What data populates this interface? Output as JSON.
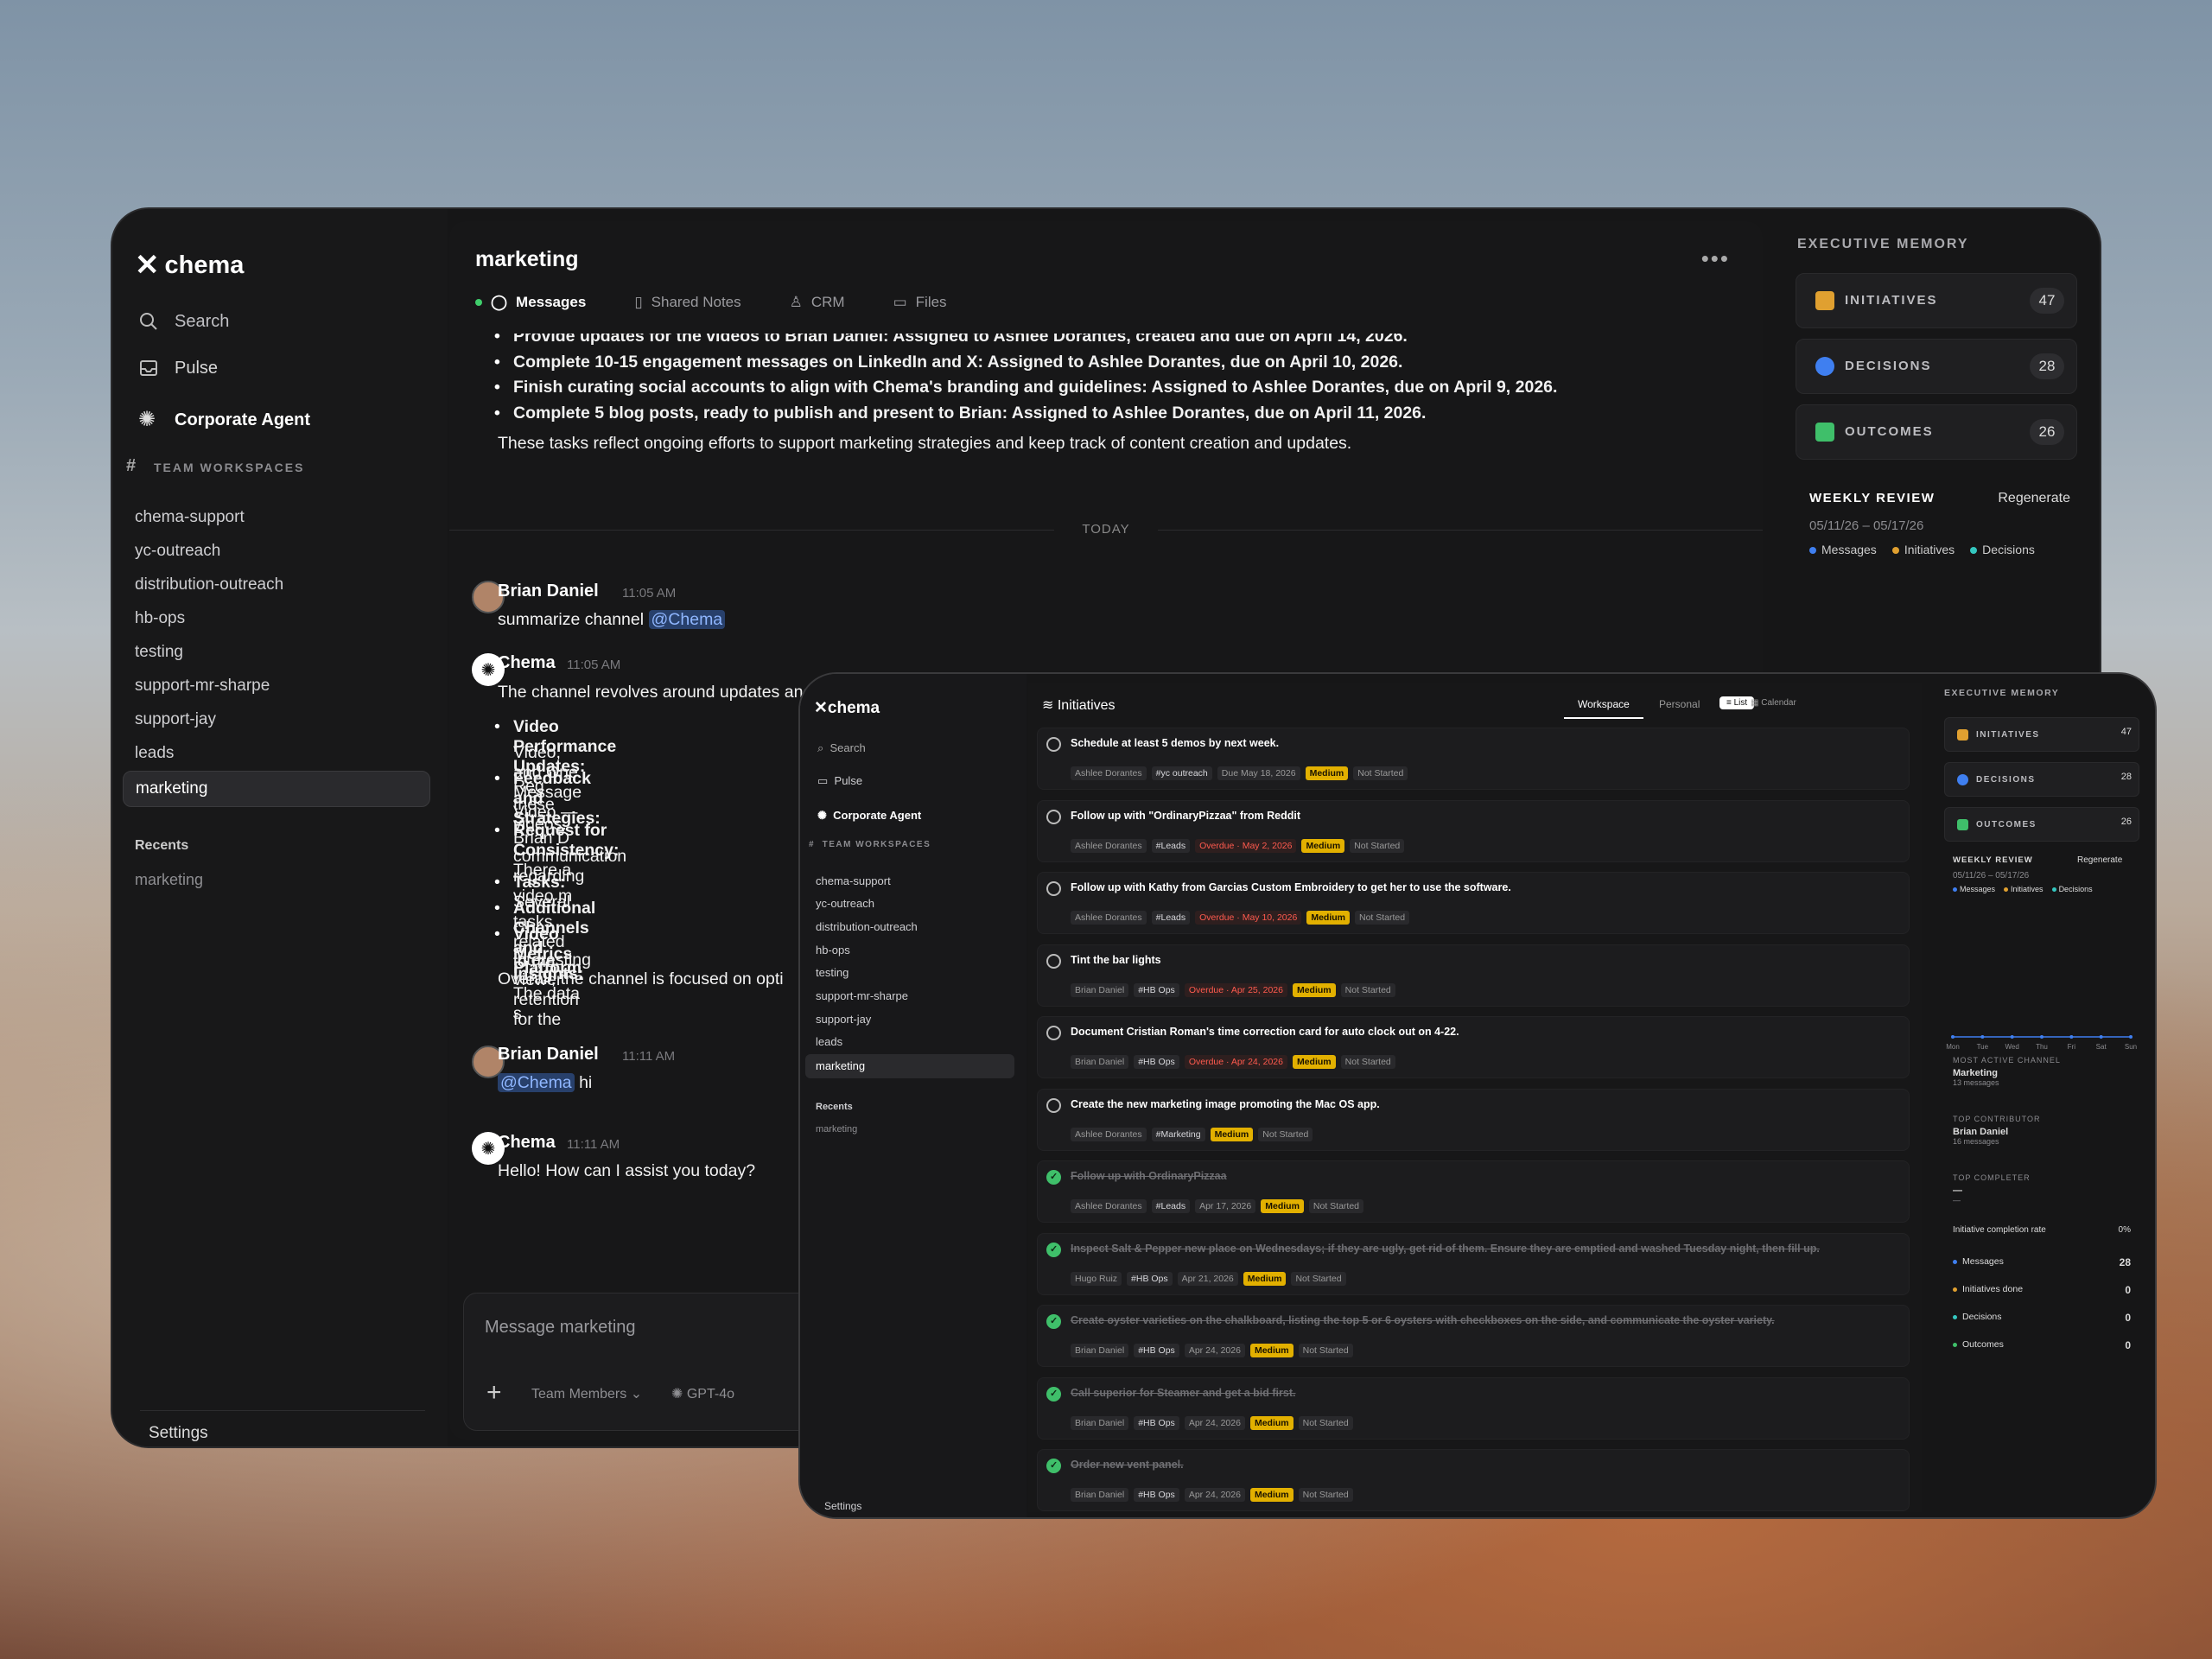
{
  "app": {
    "name": "chema"
  },
  "nav": {
    "search": "Search",
    "pulse": "Pulse",
    "agent": "Corporate Agent",
    "section": "TEAM WORKSPACES",
    "recents_label": "Recents",
    "settings": "Settings"
  },
  "channels": [
    "chema-support",
    "yc-outreach",
    "distribution-outreach",
    "hb-ops",
    "testing",
    "support-mr-sharpe",
    "support-jay",
    "leads",
    "marketing"
  ],
  "recents": [
    "marketing"
  ],
  "channel": {
    "title": "marketing",
    "tabs": [
      "Messages",
      "Shared Notes",
      "CRM",
      "Files"
    ]
  },
  "history": {
    "bullets": [
      {
        "bold": "Provide updates for the videos to Brian Daniel: Assigned to Ashlee Dorantes, created and due on April 14, 2026."
      },
      {
        "bold": "Complete 10-15 engagement messages on LinkedIn and X: Assigned to Ashlee Dorantes, due on April 10, 2026."
      },
      {
        "bold": "Finish curating social accounts to align with Chema's branding and guidelines: Assigned to Ashlee Dorantes, due on April 9, 2026."
      },
      {
        "bold": "Complete 5 blog posts, ready to publish and present to Brian: Assigned to Ashlee Dorantes, due on April 11, 2026."
      }
    ],
    "summary": "These tasks reflect ongoing efforts to support marketing strategies and keep track of content creation and updates.",
    "today": "TODAY"
  },
  "messages": {
    "m1": {
      "user": "Brian Daniel",
      "time": "11:05 AM",
      "text": "summarize channel",
      "mention": "@Chema"
    },
    "m2": {
      "user": "Chema",
      "time": "11:05 AM",
      "intro": "The channel revolves around updates and",
      "items": [
        {
          "b": "Video Performance Updates:",
          "t": " Reg"
        },
        {
          "b": "",
          "t": "Video, and One Message Video —"
        },
        {
          "b": "Feedback and Strategies:",
          "t": " Brian D"
        },
        {
          "b": "",
          "t": "these videos."
        },
        {
          "b": "Request for Consistency:",
          "t": " There a"
        },
        {
          "b": "",
          "t": "communication regarding video m"
        },
        {
          "b": "Tasks:",
          "t": " Several tasks related to ma"
        },
        {
          "b": "Additional Channels and Platform",
          "t": ""
        },
        {
          "b": "Video Metrics Insights:",
          "t": " The data s"
        },
        {
          "b": "",
          "t": "interesting viewer retention for the"
        }
      ],
      "outro": "Overall, the channel is focused on opti"
    },
    "m3": {
      "user": "Brian Daniel",
      "time": "11:11 AM",
      "mention": "@Chema",
      "text": "hi"
    },
    "m4": {
      "user": "Chema",
      "time": "11:11 AM",
      "text": "Hello! How can I assist you today?"
    }
  },
  "composer": {
    "placeholder": "Message marketing",
    "team": "Team Members",
    "model": "GPT-4o"
  },
  "exec": {
    "label": "EXECUTIVE MEMORY",
    "cards": [
      {
        "name": "INITIATIVES",
        "count": "47",
        "color": "#e0a030"
      },
      {
        "name": "DECISIONS",
        "count": "28",
        "color": "#3f7ff0"
      },
      {
        "name": "OUTCOMES",
        "count": "26",
        "color": "#3fbf6a"
      }
    ],
    "weekly": "WEEKLY REVIEW",
    "regen": "Regenerate",
    "range": "05/11/26 – 05/17/26",
    "legend": [
      {
        "name": "Messages",
        "color": "#3f7ff0"
      },
      {
        "name": "Initiatives",
        "color": "#e0a030"
      },
      {
        "name": "Decisions",
        "color": "#34c7c0"
      }
    ]
  },
  "initiatives": {
    "title": "Initiatives",
    "view": [
      "Workspace",
      "Personal"
    ],
    "modes": [
      "List",
      "Calendar"
    ],
    "rows": [
      {
        "title": "Schedule at least 5 demos by next week.",
        "done": false,
        "owner": "Ashlee Dorantes",
        "channel": "#yc outreach",
        "due": "Due May 18, 2026",
        "overdue": false,
        "priority": "Medium",
        "status": "Not Started"
      },
      {
        "title": "Follow up with \"OrdinaryPizzaa\" from Reddit",
        "done": false,
        "owner": "Ashlee Dorantes",
        "channel": "#Leads",
        "due": "Overdue · May 2, 2026",
        "overdue": true,
        "priority": "Medium",
        "status": "Not Started"
      },
      {
        "title": "Follow up with Kathy from Garcias Custom Embroidery to get her to use the software.",
        "done": false,
        "owner": "Ashlee Dorantes",
        "channel": "#Leads",
        "due": "Overdue · May 10, 2026",
        "overdue": true,
        "priority": "Medium",
        "status": "Not Started"
      },
      {
        "title": "Tint the bar lights",
        "done": false,
        "owner": "Brian Daniel",
        "channel": "#HB Ops",
        "due": "Overdue · Apr 25, 2026",
        "overdue": true,
        "priority": "Medium",
        "status": "Not Started"
      },
      {
        "title": "Document Cristian Roman's time correction card for auto clock out on 4-22.",
        "done": false,
        "owner": "Brian Daniel",
        "channel": "#HB Ops",
        "due": "Overdue · Apr 24, 2026",
        "overdue": true,
        "priority": "Medium",
        "status": "Not Started"
      },
      {
        "title": "Create the new marketing image promoting the Mac OS app.",
        "done": false,
        "owner": "Ashlee Dorantes",
        "channel": "#Marketing",
        "due": "",
        "overdue": false,
        "priority": "Medium",
        "status": "Not Started"
      },
      {
        "title": "Follow up with OrdinaryPizzaa",
        "done": true,
        "owner": "Ashlee Dorantes",
        "channel": "#Leads",
        "due": "Apr 17, 2026",
        "overdue": false,
        "priority": "Medium",
        "status": "Not Started"
      },
      {
        "title": "Inspect Salt & Pepper new place on Wednesdays; if they are ugly, get rid of them. Ensure they are emptied and washed Tuesday night, then fill up.",
        "done": true,
        "owner": "Hugo Ruiz",
        "channel": "#HB Ops",
        "due": "Apr 21, 2026",
        "overdue": false,
        "priority": "Medium",
        "status": "Not Started"
      },
      {
        "title": "Create oyster varieties on the chalkboard, listing the top 5 or 6 oysters with checkboxes on the side, and communicate the oyster variety.",
        "done": true,
        "owner": "Brian Daniel",
        "channel": "#HB Ops",
        "due": "Apr 24, 2026",
        "overdue": false,
        "priority": "Medium",
        "status": "Not Started"
      },
      {
        "title": "Call superior for Steamer and get a bid first.",
        "done": true,
        "owner": "Brian Daniel",
        "channel": "#HB Ops",
        "due": "Apr 24, 2026",
        "overdue": false,
        "priority": "Medium",
        "status": "Not Started"
      },
      {
        "title": "Order new vent panel.",
        "done": true,
        "owner": "Brian Daniel",
        "channel": "#HB Ops",
        "due": "Apr 24, 2026",
        "overdue": false,
        "priority": "Medium",
        "status": "Not Started"
      }
    ]
  },
  "chart_data": {
    "type": "line",
    "categories": [
      "Mon",
      "Tue",
      "Wed",
      "Thu",
      "Fri",
      "Sat",
      "Sun"
    ],
    "series": [
      {
        "name": "Messages",
        "values": [
          0,
          0,
          0,
          0,
          0,
          0,
          0
        ]
      }
    ],
    "ylim": [
      0,
      1
    ]
  },
  "stats": {
    "active_label": "MOST ACTIVE CHANNEL",
    "active_value": "Marketing",
    "active_sub": "13 messages",
    "contrib_label": "TOP CONTRIBUTOR",
    "contrib_value": "Brian Daniel",
    "contrib_sub": "16 messages",
    "completer_label": "TOP COMPLETER",
    "completer_value": "—",
    "completer_sub": "—",
    "rate_label": "Initiative completion rate",
    "rate_value": "0%",
    "list": [
      {
        "name": "Messages",
        "value": "28",
        "color": "#3f7ff0"
      },
      {
        "name": "Initiatives done",
        "value": "0",
        "color": "#e0a030"
      },
      {
        "name": "Decisions",
        "value": "0",
        "color": "#34c7c0"
      },
      {
        "name": "Outcomes",
        "value": "0",
        "color": "#3fbf6a"
      }
    ]
  }
}
